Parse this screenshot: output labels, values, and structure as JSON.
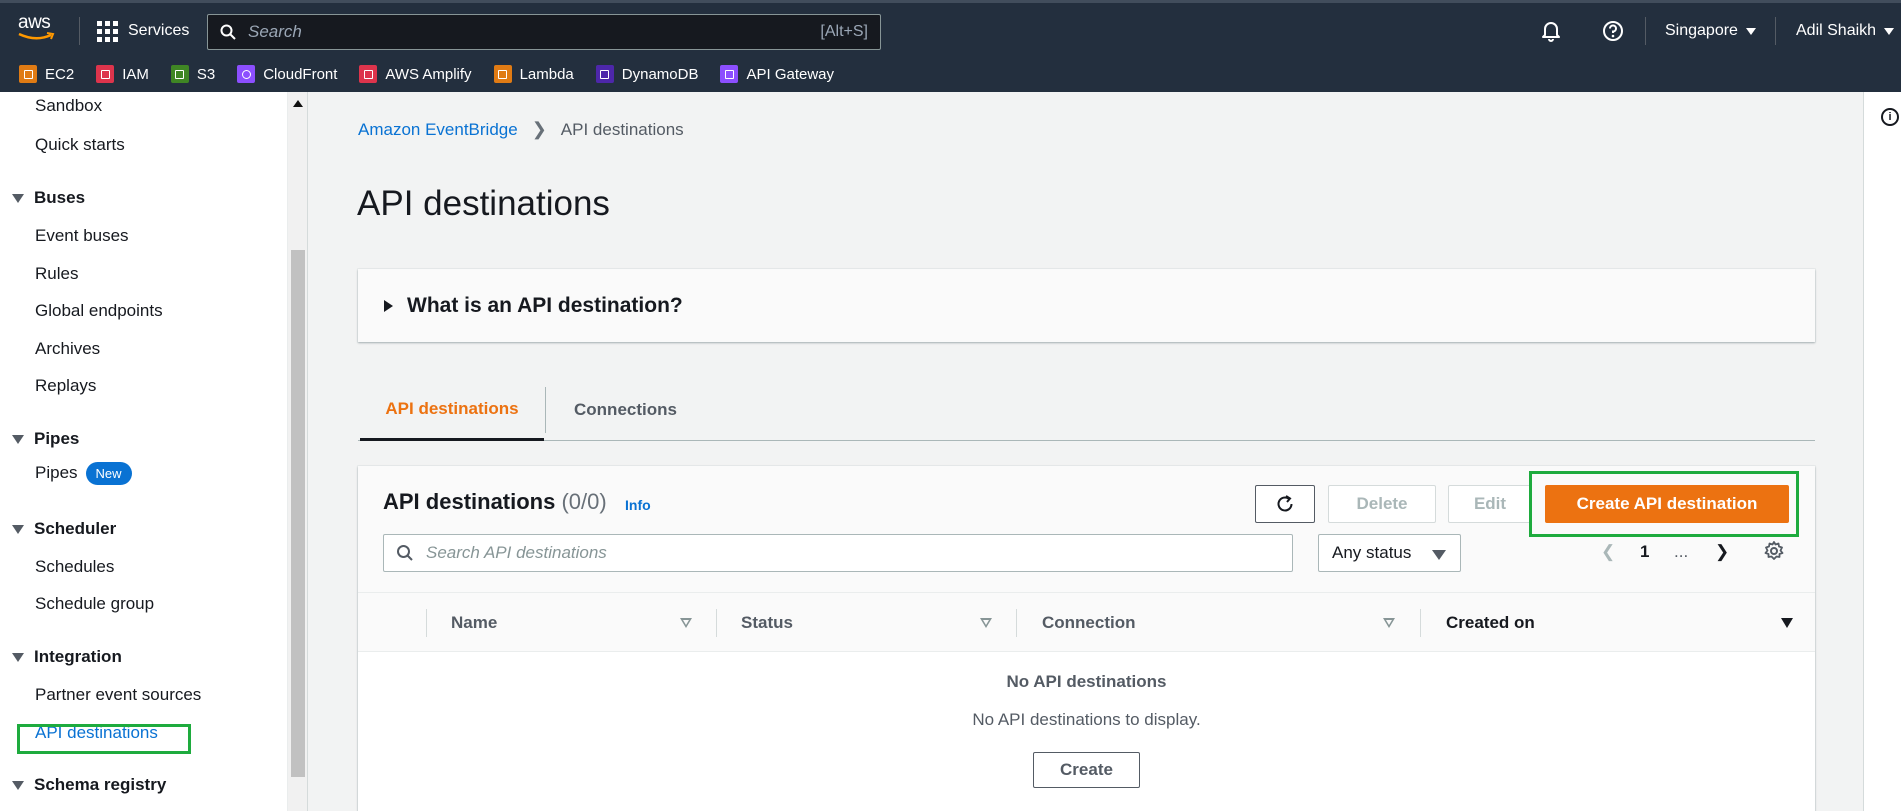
{
  "topnav": {
    "brand": "aws",
    "services_label": "Services",
    "search_placeholder": "Search",
    "search_shortcut": "[Alt+S]",
    "region": "Singapore",
    "user": "Adil Shaikh"
  },
  "favorites": [
    {
      "label": "EC2",
      "color": "#e07b14"
    },
    {
      "label": "IAM",
      "color": "#dd344c"
    },
    {
      "label": "S3",
      "color": "#3f8624"
    },
    {
      "label": "CloudFront",
      "color": "#8c4fff"
    },
    {
      "label": "AWS Amplify",
      "color": "#dd344c"
    },
    {
      "label": "Lambda",
      "color": "#e07b14"
    },
    {
      "label": "DynamoDB",
      "color": "#4d27aa"
    },
    {
      "label": "API Gateway",
      "color": "#8c4fff"
    }
  ],
  "sidebar": {
    "items": [
      {
        "label": "Sandbox"
      },
      {
        "label": "Quick starts"
      }
    ],
    "sections": [
      {
        "title": "Buses",
        "items": [
          "Event buses",
          "Rules",
          "Global endpoints",
          "Archives",
          "Replays"
        ]
      },
      {
        "title": "Pipes",
        "items": [
          "Pipes"
        ],
        "badge": "New"
      },
      {
        "title": "Scheduler",
        "items": [
          "Schedules",
          "Schedule group"
        ]
      },
      {
        "title": "Integration",
        "items": [
          "Partner event sources",
          "API destinations"
        ]
      },
      {
        "title": "Schema registry",
        "items": []
      }
    ],
    "active": "API destinations"
  },
  "breadcrumb": {
    "root": "Amazon EventBridge",
    "current": "API destinations"
  },
  "page": {
    "title": "API destinations",
    "expander_label": "What is an API destination?"
  },
  "tabs": [
    {
      "label": "API destinations",
      "active": true
    },
    {
      "label": "Connections",
      "active": false
    }
  ],
  "table": {
    "title": "API destinations",
    "count": "(0/0)",
    "info": "Info",
    "delete_label": "Delete",
    "edit_label": "Edit",
    "create_label": "Create API destination",
    "search_placeholder": "Search API destinations",
    "status_filter": "Any status",
    "page": "1",
    "ellipsis": "...",
    "columns": [
      "Name",
      "Status",
      "Connection",
      "Created on"
    ],
    "empty_title": "No API destinations",
    "empty_message": "No API destinations to display.",
    "empty_create": "Create"
  },
  "colors": {
    "accent": "#ec7211",
    "link": "#0972d3",
    "highlight": "#1eab3e",
    "nav_bg": "#232f3e"
  }
}
